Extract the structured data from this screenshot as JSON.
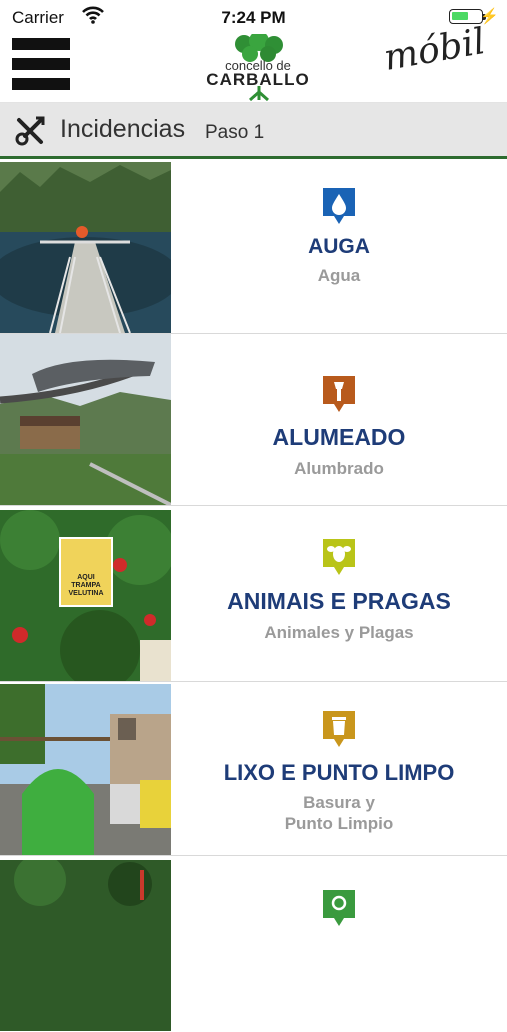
{
  "status_bar": {
    "carrier": "Carrier",
    "time": "7:24 PM",
    "battery_level": 0.6,
    "wifi_icon": "wifi-icon",
    "charging_icon": "charging-bolt-icon"
  },
  "header": {
    "menu_icon": "hamburger-menu-icon",
    "logo_line1": "concello de",
    "logo_line2": "CARBALLO",
    "brand_suffix": "móbil"
  },
  "title_bar": {
    "icon": "tools-icon",
    "title": "Incidencias",
    "step": "Paso 1"
  },
  "categories": [
    {
      "label": "AUGA",
      "sublabel": "Agua",
      "icon": "water-drop-icon",
      "color": "#1a63b5"
    },
    {
      "label": "ALUMEADO",
      "sublabel": "Alumbrado",
      "icon": "torch-icon",
      "color": "#b85a1c"
    },
    {
      "label": "ANIMAIS E PRAGAS",
      "sublabel": "Animales y Plagas",
      "icon": "bee-icon",
      "color": "#b9c418"
    },
    {
      "label": "LIXO E PUNTO LIMPO",
      "sublabel": "Basura y\nPunto Limpio",
      "icon": "trash-can-icon",
      "color": "#c9961c"
    },
    {
      "label": "",
      "sublabel": "",
      "icon": "recycle-icon",
      "color": "#3a9a3e"
    }
  ],
  "photo_sign": {
    "line1": "AQUI",
    "line2": "TRAMPA",
    "line3": "VELUTINA"
  },
  "colors": {
    "accent_green": "#2d6b2f",
    "label_blue": "#1e3c78",
    "sublabel_gray": "#9a9a9a",
    "title_bar_bg": "#e6e6e6"
  }
}
